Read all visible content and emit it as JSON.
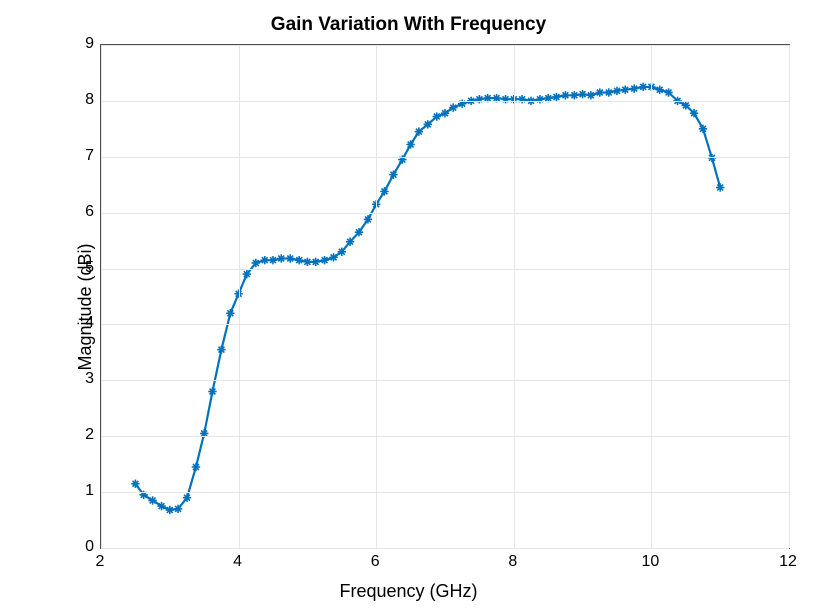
{
  "chart_data": {
    "type": "line",
    "title": "Gain Variation With Frequency",
    "xlabel": "Frequency (GHz)",
    "ylabel": "Magnitude (dBi)",
    "xlim": [
      2,
      12
    ],
    "ylim": [
      0,
      9
    ],
    "xticks": [
      2,
      4,
      6,
      8,
      10,
      12
    ],
    "yticks": [
      0,
      1,
      2,
      3,
      4,
      5,
      6,
      7,
      8,
      9
    ],
    "grid": true,
    "color": "#0072BD",
    "marker": "star",
    "x": [
      2.5,
      2.62,
      2.75,
      2.88,
      3.0,
      3.12,
      3.25,
      3.38,
      3.5,
      3.62,
      3.75,
      3.88,
      4.0,
      4.12,
      4.25,
      4.38,
      4.5,
      4.62,
      4.75,
      4.88,
      5.0,
      5.12,
      5.25,
      5.38,
      5.5,
      5.62,
      5.75,
      5.88,
      6.0,
      6.12,
      6.25,
      6.38,
      6.5,
      6.62,
      6.75,
      6.88,
      7.0,
      7.12,
      7.25,
      7.38,
      7.5,
      7.62,
      7.75,
      7.88,
      8.0,
      8.12,
      8.25,
      8.38,
      8.5,
      8.62,
      8.75,
      8.88,
      9.0,
      9.12,
      9.25,
      9.38,
      9.5,
      9.62,
      9.75,
      9.88,
      10.0,
      10.12,
      10.25,
      10.38,
      10.5,
      10.62,
      10.75,
      10.88,
      11.0
    ],
    "y": [
      1.15,
      0.95,
      0.85,
      0.75,
      0.68,
      0.7,
      0.9,
      1.45,
      2.05,
      2.8,
      3.55,
      4.2,
      4.55,
      4.9,
      5.1,
      5.15,
      5.15,
      5.18,
      5.18,
      5.15,
      5.12,
      5.12,
      5.15,
      5.2,
      5.3,
      5.48,
      5.65,
      5.88,
      6.15,
      6.38,
      6.68,
      6.95,
      7.22,
      7.45,
      7.58,
      7.72,
      7.78,
      7.88,
      7.95,
      8.0,
      8.03,
      8.05,
      8.05,
      8.03,
      8.03,
      8.03,
      8.0,
      8.03,
      8.05,
      8.07,
      8.1,
      8.1,
      8.12,
      8.1,
      8.15,
      8.15,
      8.18,
      8.2,
      8.22,
      8.25,
      8.25,
      8.2,
      8.15,
      8.0,
      7.92,
      7.78,
      7.5,
      6.98,
      6.45
    ]
  }
}
